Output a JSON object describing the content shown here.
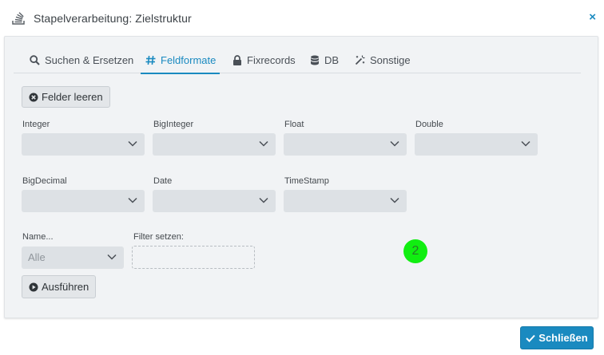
{
  "dialog": {
    "title": "Stapelverarbeitung: Zielstruktur",
    "close_label": "×"
  },
  "tabs": [
    {
      "label": "Suchen & Ersetzen",
      "icon": "search-icon",
      "active": false
    },
    {
      "label": "Feldformate",
      "icon": "hash-icon",
      "active": true
    },
    {
      "label": "Fixrecords",
      "icon": "lock-icon",
      "active": false
    },
    {
      "label": "DB",
      "icon": "database-icon",
      "active": false
    },
    {
      "label": "Sonstige",
      "icon": "magic-wand-icon",
      "active": false
    }
  ],
  "clear_button": {
    "label": "Felder leeren",
    "icon": "times-circle-icon"
  },
  "fields": {
    "integer": {
      "label": "Integer",
      "value": ""
    },
    "biginteger": {
      "label": "BigInteger",
      "value": ""
    },
    "float": {
      "label": "Float",
      "value": ""
    },
    "double": {
      "label": "Double",
      "value": ""
    },
    "bigdecimal": {
      "label": "BigDecimal",
      "value": ""
    },
    "date": {
      "label": "Date",
      "value": ""
    },
    "timestamp": {
      "label": "TimeStamp",
      "value": ""
    }
  },
  "name_select": {
    "label": "Name...",
    "value": "Alle"
  },
  "filter": {
    "label": "Filter setzen:",
    "value": ""
  },
  "run_button": {
    "label": "Ausführen",
    "icon": "play-circle-icon"
  },
  "marker": {
    "text": "2"
  },
  "close_button": {
    "label": "Schließen",
    "icon": "check-icon"
  },
  "colors": {
    "accent": "#1a8ac0",
    "panel": "#f1f3f5",
    "select": "#dde1e5",
    "marker": "#11ee11"
  }
}
